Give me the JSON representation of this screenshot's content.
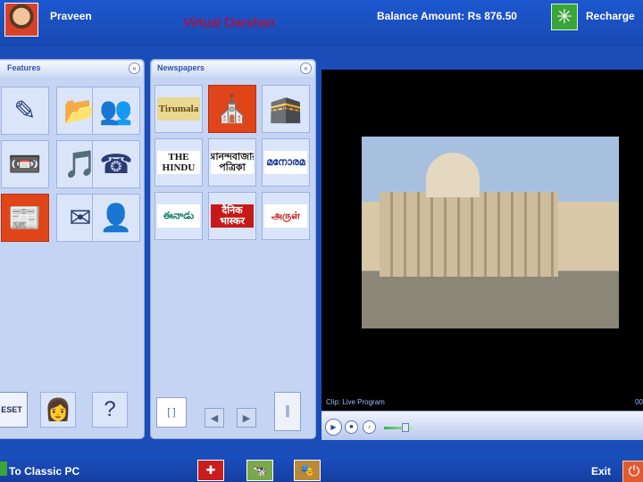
{
  "header": {
    "user_name": "Praveen",
    "app_title": "Virtual Darshan",
    "balance": "Balance Amount: Rs 876.50",
    "recharge_label": "Recharge"
  },
  "features_panel": {
    "title": "Features",
    "collapse_glyph": "«",
    "tiles": [
      {
        "icon": "✎"
      },
      {
        "icon": "📂"
      },
      {
        "icon": "👥"
      },
      {
        "icon": "📼"
      },
      {
        "icon": "🎵"
      },
      {
        "icon": "☎"
      },
      {
        "icon": "📰"
      },
      {
        "icon": "✉"
      },
      {
        "icon": "👤"
      }
    ],
    "reset_label": "ESET",
    "help_glyph": "?",
    "photo_glyph": "👩"
  },
  "newspapers_panel": {
    "title": "Newspapers",
    "collapse_glyph": "«",
    "tiles": [
      {
        "label": "Tirumala"
      },
      {
        "label": "⛪"
      },
      {
        "label": "🕋"
      },
      {
        "label": "THE HINDU"
      },
      {
        "label": "আনন্দবাজার পত্রিকা"
      },
      {
        "label": "മനോരമ"
      },
      {
        "label": "ఈనాడు"
      },
      {
        "label": "दैनिक भास्कर"
      },
      {
        "label": "அருள்"
      }
    ],
    "control_glyph": "[ ]",
    "prev_glyph": "◀",
    "next_glyph": "▶",
    "slider_glyph": "║"
  },
  "player": {
    "clip_label": "Clip: Live Program",
    "clip_time": "00",
    "play_glyph": "▶",
    "stop_glyph": "■",
    "mute_glyph": "♪",
    "volume_level": 0.75
  },
  "footer": {
    "classic_label": "To Classic PC",
    "exit_label": "Exit",
    "exit_glyph": "⏻",
    "dock": [
      {
        "glyph": "✚"
      },
      {
        "glyph": "🐄"
      },
      {
        "glyph": "🎭"
      }
    ]
  },
  "colors": {
    "bar_blue": "#1a4db8",
    "title_red": "#d4001a",
    "panel_bg": "#c5d4f2",
    "selected_tile": "#e0451a"
  }
}
